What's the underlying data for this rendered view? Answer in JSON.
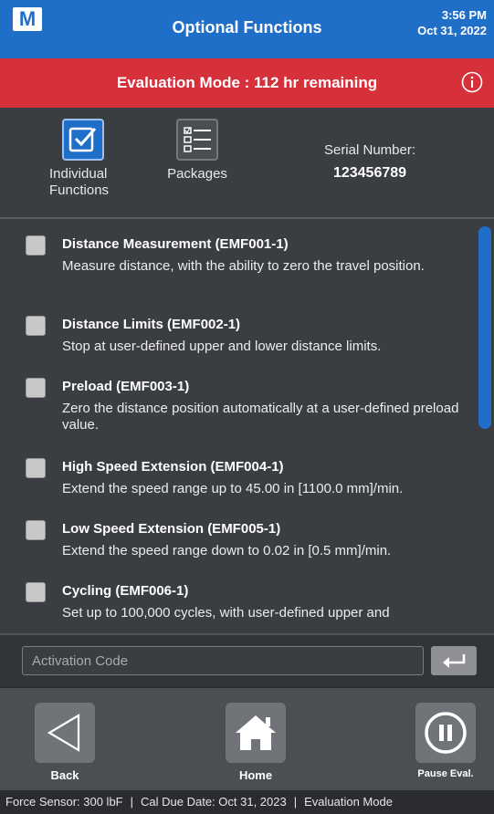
{
  "header": {
    "logo_letter": "M",
    "title": "Optional Functions",
    "time": "3:56 PM",
    "date": "Oct 31, 2022"
  },
  "eval_banner": {
    "text": "Evaluation Mode : 112 hr remaining"
  },
  "tabs": {
    "individual_label": "Individual Functions",
    "packages_label": "Packages"
  },
  "serial": {
    "label": "Serial Number:",
    "value": "123456789"
  },
  "functions": [
    {
      "title": "Distance Measurement (EMF001-1)",
      "desc": "Measure distance, with the ability to zero the travel position."
    },
    {
      "title": "Distance Limits (EMF002-1)",
      "desc": "Stop at user-defined upper and lower distance limits."
    },
    {
      "title": "Preload (EMF003-1)",
      "desc": "Zero the distance position automatically at a user-defined preload value."
    },
    {
      "title": "High Speed Extension (EMF004-1)",
      "desc": "Extend the speed range up to 45.00 in [1100.0 mm]/min."
    },
    {
      "title": "Low Speed Extension (EMF005-1)",
      "desc": "Extend the speed range down to 0.02 in [0.5 mm]/min."
    },
    {
      "title": "Cycling (EMF006-1)",
      "desc": "Set up to 100,000 cycles, with user-defined upper and"
    }
  ],
  "activation": {
    "placeholder": "Activation Code"
  },
  "nav": {
    "back": "Back",
    "home": "Home",
    "pause": "Pause Eval."
  },
  "status": {
    "sensor": "Force Sensor: 300 lbF",
    "cal_due": "Cal Due Date: Oct 31, 2023",
    "mode": "Evaluation Mode"
  },
  "colors": {
    "header_blue": "#1f6fc9",
    "eval_red": "#d6303b",
    "background": "#3a3d41"
  }
}
